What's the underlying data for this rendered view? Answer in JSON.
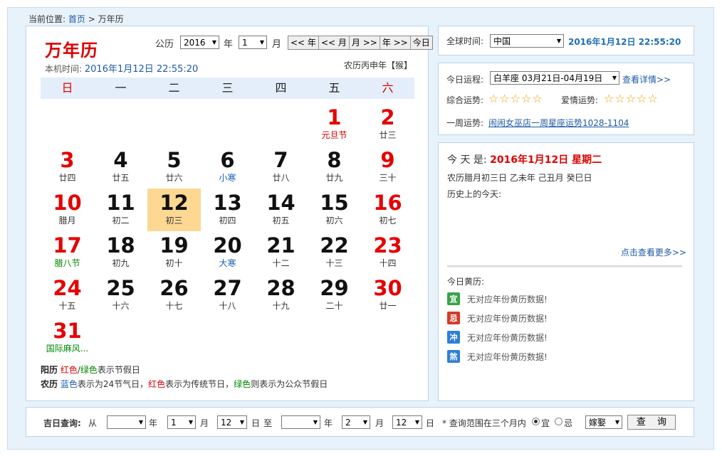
{
  "breadcrumb": {
    "prefix": "当前位置:",
    "home": "首页",
    "sep": ">",
    "current": "万年历"
  },
  "calendar": {
    "title": "万年历",
    "local_time_label": "本机时间:",
    "local_time_value": "2016年1月12日 22:55:20",
    "lunar_year": "农历丙申年【猴】",
    "gongli_label": "公历",
    "year_value": "2016",
    "year_label": "年",
    "month_value": "1",
    "month_label": "月",
    "nav_buttons": [
      "<< 年",
      "<< 月",
      "月 >>",
      "年 >>",
      "今日"
    ],
    "weekdays": [
      "日",
      "一",
      "二",
      "三",
      "四",
      "五",
      "六"
    ],
    "days": [
      {
        "d": "1",
        "sub": "元旦节",
        "c": "red",
        "s": "red"
      },
      {
        "d": "2",
        "sub": "廿三",
        "c": "red",
        "s": ""
      },
      {
        "d": "3",
        "sub": "廿四",
        "c": "red",
        "s": ""
      },
      {
        "d": "4",
        "sub": "廿五",
        "c": "black",
        "s": ""
      },
      {
        "d": "5",
        "sub": "廿六",
        "c": "black",
        "s": ""
      },
      {
        "d": "6",
        "sub": "小寒",
        "c": "black",
        "s": "blue"
      },
      {
        "d": "7",
        "sub": "廿八",
        "c": "black",
        "s": ""
      },
      {
        "d": "8",
        "sub": "廿九",
        "c": "black",
        "s": ""
      },
      {
        "d": "9",
        "sub": "三十",
        "c": "red",
        "s": ""
      },
      {
        "d": "10",
        "sub": "腊月",
        "c": "red",
        "s": ""
      },
      {
        "d": "11",
        "sub": "初二",
        "c": "black",
        "s": ""
      },
      {
        "d": "12",
        "sub": "初三",
        "c": "black",
        "s": "",
        "today": true
      },
      {
        "d": "13",
        "sub": "初四",
        "c": "black",
        "s": ""
      },
      {
        "d": "14",
        "sub": "初五",
        "c": "black",
        "s": ""
      },
      {
        "d": "15",
        "sub": "初六",
        "c": "black",
        "s": ""
      },
      {
        "d": "16",
        "sub": "初七",
        "c": "red",
        "s": ""
      },
      {
        "d": "17",
        "sub": "腊八节",
        "c": "red",
        "s": "green"
      },
      {
        "d": "18",
        "sub": "初九",
        "c": "black",
        "s": ""
      },
      {
        "d": "19",
        "sub": "初十",
        "c": "black",
        "s": ""
      },
      {
        "d": "20",
        "sub": "大寒",
        "c": "black",
        "s": "blue"
      },
      {
        "d": "21",
        "sub": "十二",
        "c": "black",
        "s": ""
      },
      {
        "d": "22",
        "sub": "十三",
        "c": "black",
        "s": ""
      },
      {
        "d": "23",
        "sub": "十四",
        "c": "red",
        "s": ""
      },
      {
        "d": "24",
        "sub": "十五",
        "c": "red",
        "s": ""
      },
      {
        "d": "25",
        "sub": "十六",
        "c": "black",
        "s": ""
      },
      {
        "d": "26",
        "sub": "十七",
        "c": "black",
        "s": ""
      },
      {
        "d": "27",
        "sub": "十八",
        "c": "black",
        "s": ""
      },
      {
        "d": "28",
        "sub": "十九",
        "c": "black",
        "s": ""
      },
      {
        "d": "29",
        "sub": "二十",
        "c": "black",
        "s": ""
      },
      {
        "d": "30",
        "sub": "廿一",
        "c": "red",
        "s": ""
      },
      {
        "d": "31",
        "sub": "国际麻风...",
        "c": "red",
        "s": "green"
      }
    ],
    "legend1": {
      "label": "阳历",
      "red": "红色",
      "slash": "/",
      "green": "绿色",
      "rest": "表示节假日"
    },
    "legend2": {
      "label": "农历",
      "blue": "蓝色",
      "t1": "表示为24节气日，",
      "red": "红色",
      "t2": "表示为传统节日，",
      "green": "绿色",
      "t3": "则表示为公众节假日"
    }
  },
  "timezone": {
    "label": "全球时间:",
    "value": "中国",
    "time": "2016年1月12日  22:55:20"
  },
  "fortune": {
    "label": "今日运程:",
    "zodiac_value": "白羊座 03月21日-04月19日",
    "detail_link": "查看详情>>",
    "overall_label": "综合运势:",
    "love_label": "爱情运势:",
    "overall_stars": 0,
    "love_stars": 0,
    "week_label": "一周运势:",
    "week_link": "闹闹女巫店一周星座运势1028-1104"
  },
  "today": {
    "prefix": "今 天 是:",
    "date": "2016年1月12日  星期二",
    "lunar": "农历腊月初三日  乙未年  己丑月  癸巳日",
    "history_label": "历史上的今天:",
    "more_link": "点击查看更多>>",
    "almanac_label": "今日黄历:",
    "almanac": [
      {
        "badge": "宜",
        "color": "#3aa34a",
        "text": "无对应年份黄历数据!"
      },
      {
        "badge": "忌",
        "color": "#d63a2a",
        "text": "无对应年份黄历数据!"
      },
      {
        "badge": "冲",
        "color": "#2f7fd8",
        "text": "无对应年份黄历数据!"
      },
      {
        "badge": "煞",
        "color": "#2f7fd8",
        "text": "无对应年份黄历数据!"
      }
    ]
  },
  "query": {
    "label": "吉日查询:",
    "from": "从",
    "year_label": "年",
    "month_label": "月",
    "day_label": "日",
    "to": "至",
    "from_year": "",
    "from_month": "1",
    "from_day": "12",
    "to_year": "",
    "to_month": "2",
    "to_day": "12",
    "note": "* 查询范围在三个月内",
    "yi": "宜",
    "ji": "忌",
    "event_value": "嫁娶",
    "button": "查 询"
  }
}
